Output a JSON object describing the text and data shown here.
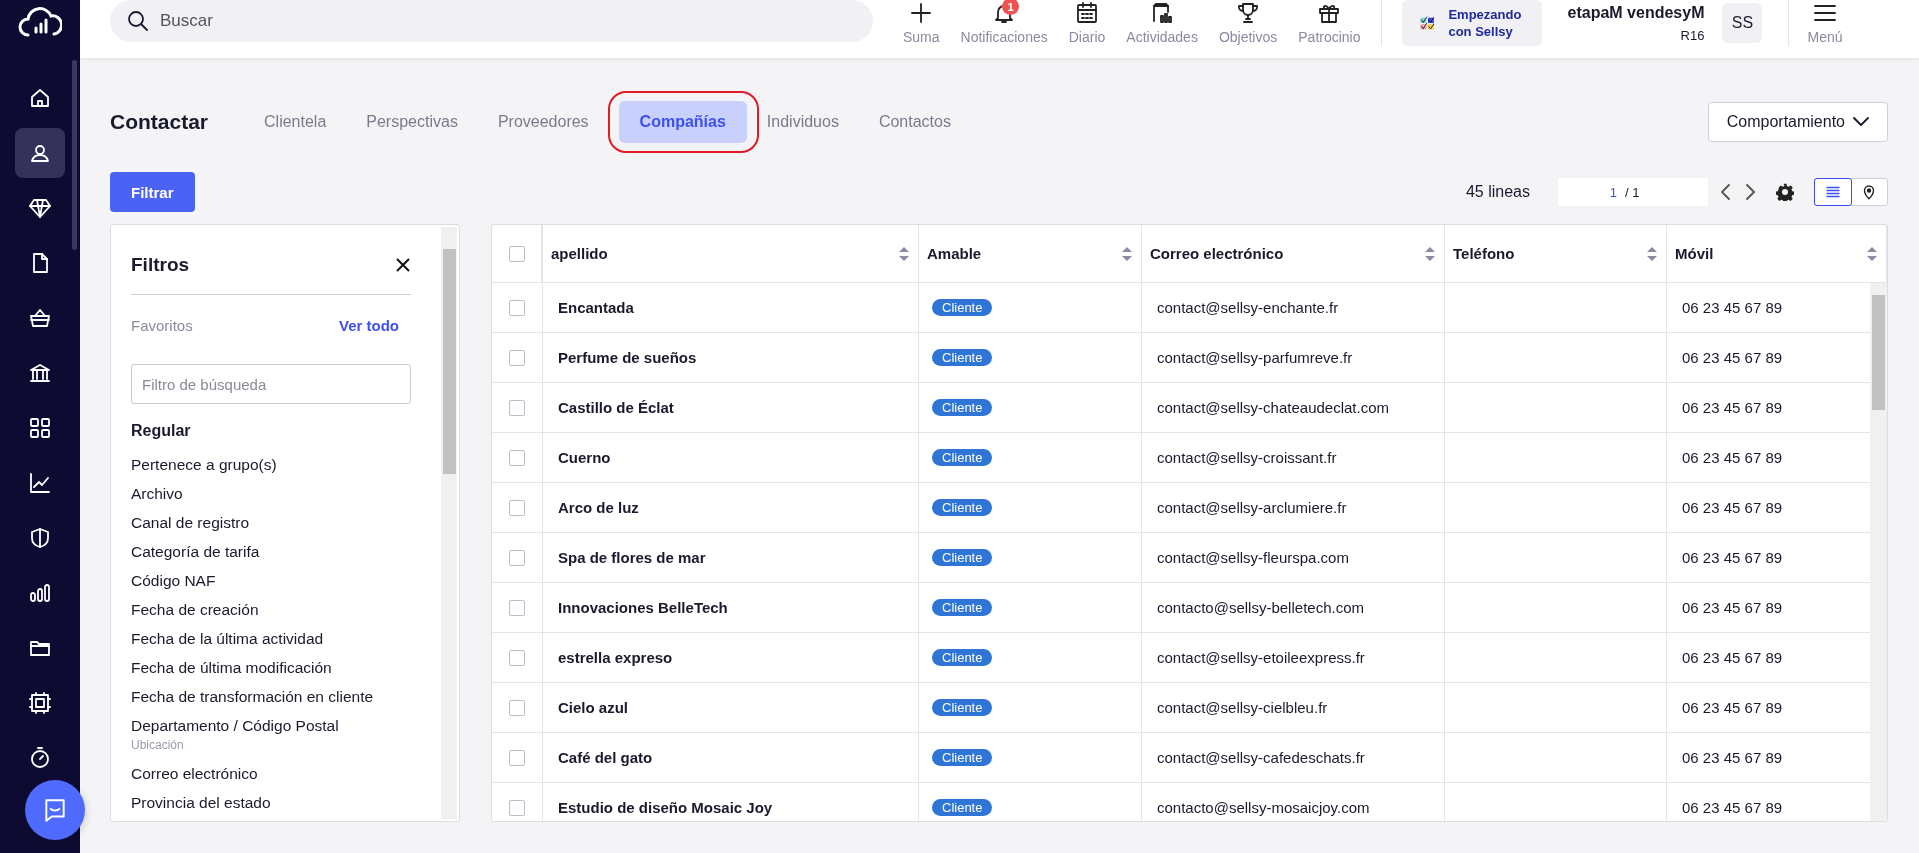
{
  "sidebar": {
    "items": [
      {
        "kind": "home",
        "selected": false
      },
      {
        "kind": "person",
        "selected": true
      },
      {
        "kind": "gem",
        "selected": false
      },
      {
        "kind": "file",
        "selected": false
      },
      {
        "kind": "basket",
        "selected": false
      },
      {
        "kind": "bank",
        "selected": false
      },
      {
        "kind": "grid",
        "selected": false
      },
      {
        "kind": "trend",
        "selected": false
      },
      {
        "kind": "shield",
        "selected": false
      },
      {
        "kind": "bars",
        "selected": false
      },
      {
        "kind": "folder",
        "selected": false
      },
      {
        "kind": "stamp",
        "selected": false
      },
      {
        "kind": "timer",
        "selected": false
      }
    ]
  },
  "top_bar": {
    "search": {
      "placeholder": "Buscar"
    },
    "actions": [
      {
        "kind": "plus",
        "label": "Suma"
      },
      {
        "kind": "bell",
        "label": "Notificaciones",
        "badge": "1"
      },
      {
        "kind": "calendar",
        "label": "Diario"
      },
      {
        "kind": "activity",
        "label": "Actividades"
      },
      {
        "kind": "trophy",
        "label": "Objetivos"
      },
      {
        "kind": "gift",
        "label": "Patrocinio"
      }
    ],
    "onboarding": {
      "label": "Empezando con Sellsy"
    },
    "user": {
      "name": "etapaM vendesyM",
      "code": "R16",
      "initials": "SS"
    },
    "menu": {
      "label": "Menú"
    }
  },
  "header": {
    "title": "Contactar",
    "tabs": [
      {
        "label": "Clientela",
        "selected": false,
        "circled": false
      },
      {
        "label": "Perspectivas",
        "selected": false,
        "circled": false
      },
      {
        "label": "Proveedores",
        "selected": false,
        "circled": false
      },
      {
        "label": "Compañías",
        "selected": true,
        "circled": true
      },
      {
        "label": "Individuos",
        "selected": false,
        "circled": false
      },
      {
        "label": "Contactos",
        "selected": false,
        "circled": false
      }
    ],
    "behavior_button": "Comportamiento"
  },
  "toolbar": {
    "filter_button": "Filtrar",
    "row_count": "45 lineas",
    "page": "1",
    "page_total": "/ 1",
    "views": [
      {
        "kind": "list",
        "selected": true
      },
      {
        "kind": "map",
        "selected": false
      }
    ]
  },
  "filters": {
    "title": "Filtros",
    "favorites_label": "Favoritos",
    "see_all": "Ver todo",
    "search": {
      "placeholder": "Filtro de búsqueda"
    },
    "section": "Regular",
    "items": [
      {
        "label": "Pertenece a grupo(s)"
      },
      {
        "label": "Archivo"
      },
      {
        "label": "Canal de registro"
      },
      {
        "label": "Categoría de tarifa"
      },
      {
        "label": "Código NAF"
      },
      {
        "label": "Fecha de creación"
      },
      {
        "label": "Fecha de la última actividad"
      },
      {
        "label": "Fecha de última modificación"
      },
      {
        "label": "Fecha de transformación en cliente"
      },
      {
        "label": "Departamento / Código Postal",
        "sublabel": "Ubicación"
      },
      {
        "label": "Correo electrónico"
      },
      {
        "label": "Provincia del estado"
      }
    ]
  },
  "table": {
    "all_checked": false,
    "columns": [
      "apellido",
      "Amable",
      "Correo electrónico",
      "Teléfono",
      "Móvil"
    ],
    "rows": [
      {
        "checked": false,
        "name": "Encantada",
        "type": "Cliente",
        "email": "contact@sellsy-enchante.fr",
        "mobile": "06 23 45 67 89"
      },
      {
        "checked": false,
        "name": "Perfume de sueños",
        "type": "Cliente",
        "email": "contact@sellsy-parfumreve.fr",
        "mobile": "06 23 45 67 89"
      },
      {
        "checked": false,
        "name": "Castillo de Éclat",
        "type": "Cliente",
        "email": "contact@sellsy-chateaudeclat.com",
        "mobile": "06 23 45 67 89"
      },
      {
        "checked": false,
        "name": "Cuerno",
        "type": "Cliente",
        "email": "contact@sellsy-croissant.fr",
        "mobile": "06 23 45 67 89"
      },
      {
        "checked": false,
        "name": "Arco de luz",
        "type": "Cliente",
        "email": "contact@sellsy-arclumiere.fr",
        "mobile": "06 23 45 67 89"
      },
      {
        "checked": false,
        "name": "Spa de flores de mar",
        "type": "Cliente",
        "email": "contact@sellsy-fleurspa.com",
        "mobile": "06 23 45 67 89"
      },
      {
        "checked": false,
        "name": "Innovaciones BelleTech",
        "type": "Cliente",
        "email": "contacto@sellsy-belletech.com",
        "mobile": "06 23 45 67 89"
      },
      {
        "checked": false,
        "name": "estrella expreso",
        "type": "Cliente",
        "email": "contact@sellsy-etoileexpress.fr",
        "mobile": "06 23 45 67 89"
      },
      {
        "checked": false,
        "name": "Cielo azul",
        "type": "Cliente",
        "email": "contact@sellsy-cielbleu.fr",
        "mobile": "06 23 45 67 89"
      },
      {
        "checked": false,
        "name": "Café del gato",
        "type": "Cliente",
        "email": "contact@sellsy-cafedeschats.fr",
        "mobile": "06 23 45 67 89"
      },
      {
        "checked": false,
        "name": "Estudio de diseño Mosaic Joy",
        "type": "Cliente",
        "email": "contacto@sellsy-mosaicjoy.com",
        "mobile": "06 23 45 67 89"
      }
    ]
  }
}
